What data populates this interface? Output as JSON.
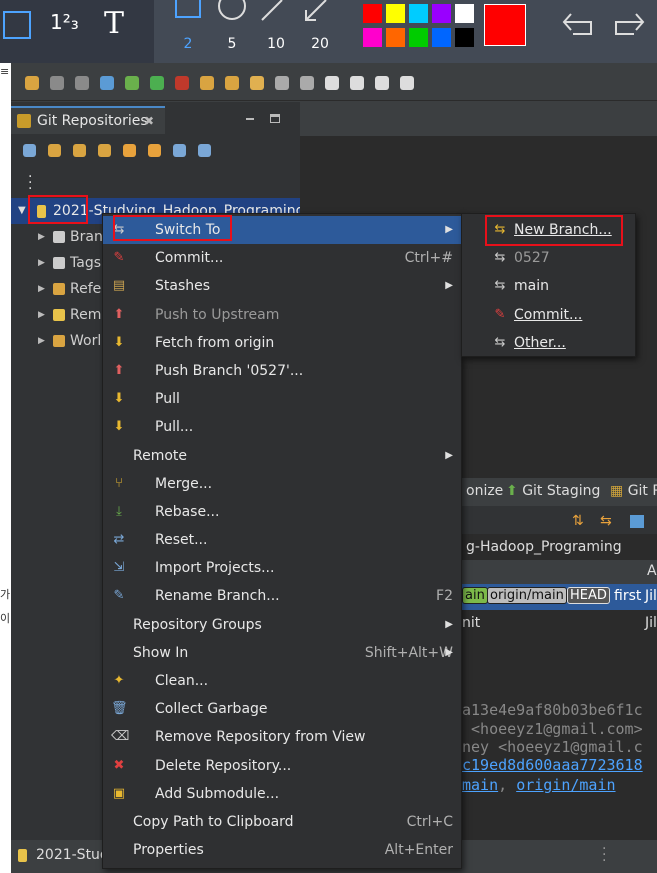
{
  "snip_toolbar": {
    "text_tool_label": "T",
    "numbering_tool_label": "1²₃",
    "pen_sizes": [
      "2",
      "5",
      "10",
      "20"
    ],
    "selected_pen_size": "2",
    "colors": [
      "#ff0000",
      "#ffff00",
      "#00ccff",
      "#9900ff",
      "#ffffff",
      "#ff00cc",
      "#ff6600",
      "#00cc00",
      "#0066ff",
      "#000000"
    ],
    "current_color": "#ff0000"
  },
  "view": {
    "tab_title": "Git Repositories",
    "repo_label": "2021-Studying_Hadoop_Programing [",
    "tree_items": [
      "Bran",
      "Tags",
      "Refe",
      "Rem",
      "Worl"
    ]
  },
  "context_menu": {
    "items": [
      {
        "label": "Switch To",
        "shortcut": "",
        "submenu": true,
        "icon": "switch-branch-icon"
      },
      {
        "label": "Commit...",
        "shortcut": "Ctrl+#",
        "submenu": false,
        "icon": "commit-icon"
      },
      {
        "label": "Stashes",
        "shortcut": "",
        "submenu": true,
        "icon": "stash-icon"
      },
      {
        "label": "Push to Upstream",
        "shortcut": "",
        "submenu": false,
        "disabled": true,
        "icon": "push-icon"
      },
      {
        "label": "Fetch from origin",
        "shortcut": "",
        "submenu": false,
        "icon": "fetch-icon"
      },
      {
        "label": "Push Branch '0527'...",
        "shortcut": "",
        "submenu": false,
        "icon": "push-branch-icon"
      },
      {
        "label": "Pull",
        "shortcut": "",
        "submenu": false,
        "icon": "pull-icon"
      },
      {
        "label": "Pull...",
        "shortcut": "",
        "submenu": false,
        "icon": "pull-dialog-icon"
      },
      {
        "label": "Remote",
        "shortcut": "",
        "submenu": true,
        "icon": ""
      },
      {
        "label": "Merge...",
        "shortcut": "",
        "submenu": false,
        "icon": "merge-icon"
      },
      {
        "label": "Rebase...",
        "shortcut": "",
        "submenu": false,
        "icon": "rebase-icon"
      },
      {
        "label": "Reset...",
        "shortcut": "",
        "submenu": false,
        "icon": "reset-icon"
      },
      {
        "label": "Import Projects...",
        "shortcut": "",
        "submenu": false,
        "icon": "import-icon"
      },
      {
        "label": "Rename Branch...",
        "shortcut": "F2",
        "submenu": false,
        "icon": "rename-icon"
      },
      {
        "label": "Repository Groups",
        "shortcut": "",
        "submenu": true,
        "icon": ""
      },
      {
        "label": "Show In",
        "shortcut": "Shift+Alt+W",
        "submenu": true,
        "icon": ""
      },
      {
        "label": "Clean...",
        "shortcut": "",
        "submenu": false,
        "icon": "clean-icon"
      },
      {
        "label": "Collect Garbage",
        "shortcut": "",
        "submenu": false,
        "icon": "trash-icon"
      },
      {
        "label": "Remove Repository from View",
        "shortcut": "",
        "submenu": false,
        "icon": "remove-icon"
      },
      {
        "label": "Delete Repository...",
        "shortcut": "",
        "submenu": false,
        "icon": "delete-icon"
      },
      {
        "label": "Add Submodule...",
        "shortcut": "",
        "submenu": false,
        "icon": "submodule-icon"
      },
      {
        "label": "Copy Path to Clipboard",
        "shortcut": "Ctrl+C",
        "submenu": false,
        "icon": ""
      },
      {
        "label": "Properties",
        "shortcut": "Alt+Enter",
        "submenu": false,
        "icon": ""
      }
    ]
  },
  "submenu": {
    "items": [
      {
        "label": "New Branch...",
        "disabled": false,
        "icon": "new-branch-icon"
      },
      {
        "label": "0527",
        "disabled": true,
        "icon": "branch-icon"
      },
      {
        "label": "main",
        "disabled": false,
        "icon": "branch-icon"
      },
      {
        "label": "Commit...",
        "disabled": false,
        "icon": "commit-icon"
      },
      {
        "label": "Other...",
        "disabled": false,
        "icon": "branch-icon"
      }
    ]
  },
  "right_panel": {
    "tabs": [
      "onize",
      "Git Staging",
      "Git R"
    ],
    "repo_title": "g-Hadoop_Programing",
    "col_header": "A",
    "row1_labels": [
      "ain",
      "origin/main",
      "HEAD"
    ],
    "row1_msg": "first",
    "row1_author": "Jil",
    "row2_msg": "nit",
    "row2_author": "Jil",
    "details": [
      "a13e4e9af80b03be6f1c",
      " <hoeeyz1@gmail.com>",
      "ney <hoeeyz1@gmail.c",
      "c19ed8d600aaa7723618"
    ],
    "branch_links": [
      "main",
      "origin/main"
    ]
  },
  "bottom": {
    "status_label": "2021-Stud"
  },
  "left_edge_text": [
    "≡",
    "가",
    "이"
  ]
}
